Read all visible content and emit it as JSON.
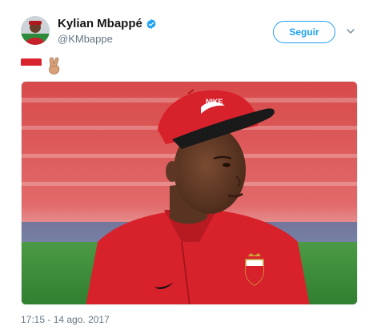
{
  "tweet": {
    "author": {
      "display_name": "Kylian Mbappé",
      "handle": "@KMbappe",
      "verified": true,
      "avatar_icon": "profile-photo"
    },
    "follow_label": "Seguir",
    "menu_icon": "chevron-down-icon",
    "text_emoji": [
      "monaco-flag-emoji",
      "victory-hand-emoji"
    ],
    "photo_description_icon": "photo",
    "timestamp": "17:15 - 14 ago. 2017"
  },
  "colors": {
    "accent": "#1da1f2",
    "secondary_text": "#657786",
    "flag_red": "#d9242f",
    "jersey_red": "#d8222b"
  }
}
